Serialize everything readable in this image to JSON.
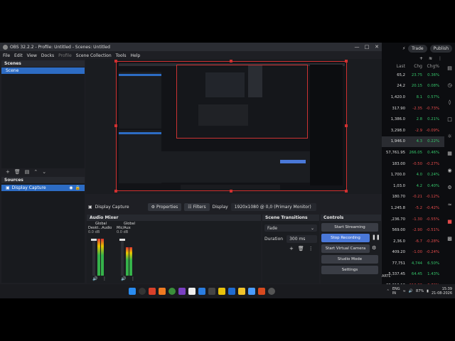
{
  "window": {
    "title": "OBS 32.2.2 - Profile: Untitled - Scenes: Untitled"
  },
  "menu": [
    "File",
    "Edit",
    "View",
    "Docks",
    "Profile",
    "Scene Collection",
    "Tools",
    "Help"
  ],
  "scenes": {
    "title": "Scenes",
    "items": [
      "Scene"
    ]
  },
  "sources": {
    "title": "Sources",
    "items": [
      {
        "label": "Display Capture"
      }
    ]
  },
  "propbar": {
    "source": "Display Capture",
    "properties": "Properties",
    "filters": "Filters",
    "display_label": "Display",
    "display_value": "1920x1080 @ 0,0 (Primary Monitor)"
  },
  "mixer": {
    "title": "Audio Mixer",
    "ch1": {
      "name": "Global",
      "device": "Deskt...Audio",
      "db": "0.0 dB"
    },
    "ch2": {
      "name": "Global",
      "device": "Mic/Aux",
      "db": "0.0 dB"
    }
  },
  "transitions": {
    "title": "Scene Transitions",
    "type": "Fade",
    "duration_label": "Duration",
    "duration_value": "300 ms"
  },
  "controls": {
    "title": "Controls",
    "start_streaming": "Start Streaming",
    "stop_recording": "Stop Recording",
    "start_virtual_camera": "Start Virtual Camera",
    "studio_mode": "Studio Mode",
    "settings": "Settings"
  },
  "stock_panel": {
    "trade": "Trade",
    "publish": "Publish",
    "col_last": "Last",
    "col_chg": "Chg",
    "col_chgp": "Chg%",
    "footer": "ARTL",
    "rows": [
      {
        "last": "65,2",
        "chg": "23.75",
        "chgp": "0.36%",
        "dir": "pos"
      },
      {
        "last": "24,2",
        "chg": "20.15",
        "chgp": "0.08%",
        "dir": "pos"
      },
      {
        "last": "1,420.0",
        "chg": "8.1",
        "chgp": "0.57%",
        "dir": "pos"
      },
      {
        "last": "317.90",
        "chg": "-2.35",
        "chgp": "-0.73%",
        "dir": "neg"
      },
      {
        "last": "1,386.0",
        "chg": "2.8",
        "chgp": "0.21%",
        "dir": "pos"
      },
      {
        "last": "3,298.0",
        "chg": "-2.9",
        "chgp": "-0.09%",
        "dir": "neg"
      },
      {
        "last": "1,946.0",
        "chg": "4.3",
        "chgp": "0.22%",
        "dir": "pos"
      },
      {
        "last": "57,761.95",
        "chg": "266.05",
        "chgp": "0.46%",
        "dir": "pos"
      },
      {
        "last": "183.00",
        "chg": "-0.50",
        "chgp": "-0.27%",
        "dir": "neg"
      },
      {
        "last": "1,700.0",
        "chg": "4.0",
        "chgp": "0.24%",
        "dir": "pos"
      },
      {
        "last": "1,03.0",
        "chg": "4.2",
        "chgp": "0.40%",
        "dir": "pos"
      },
      {
        "last": "180.70",
        "chg": "-0.21",
        "chgp": "-0.12%",
        "dir": "neg"
      },
      {
        "last": "1,245.8",
        "chg": "-5.2",
        "chgp": "-0.42%",
        "dir": "neg"
      },
      {
        "last": ",236.70",
        "chg": "-1.30",
        "chgp": "-0.55%",
        "dir": "neg"
      },
      {
        "last": "569.00",
        "chg": "-2.90",
        "chgp": "-0.51%",
        "dir": "neg"
      },
      {
        "last": "2,36.0",
        "chg": "-6.7",
        "chgp": "-0.28%",
        "dir": "neg"
      },
      {
        "last": "409.20",
        "chg": "-1.00",
        "chgp": "-0.24%",
        "dir": "neg"
      },
      {
        "last": "77,751",
        "chg": "4,744",
        "chgp": "6.50%",
        "dir": "pos"
      },
      {
        "last": "5,337.45",
        "chg": "64.45",
        "chgp": "1.43%",
        "dir": "pos"
      },
      {
        "last": "29,213.16",
        "chg": "-212.86",
        "chgp": "-0.72%",
        "dir": "neg"
      }
    ]
  },
  "tray": {
    "lang": "ENG",
    "region": "IN",
    "battery": "87%",
    "time": "15:39",
    "date": "21-08-2026"
  }
}
